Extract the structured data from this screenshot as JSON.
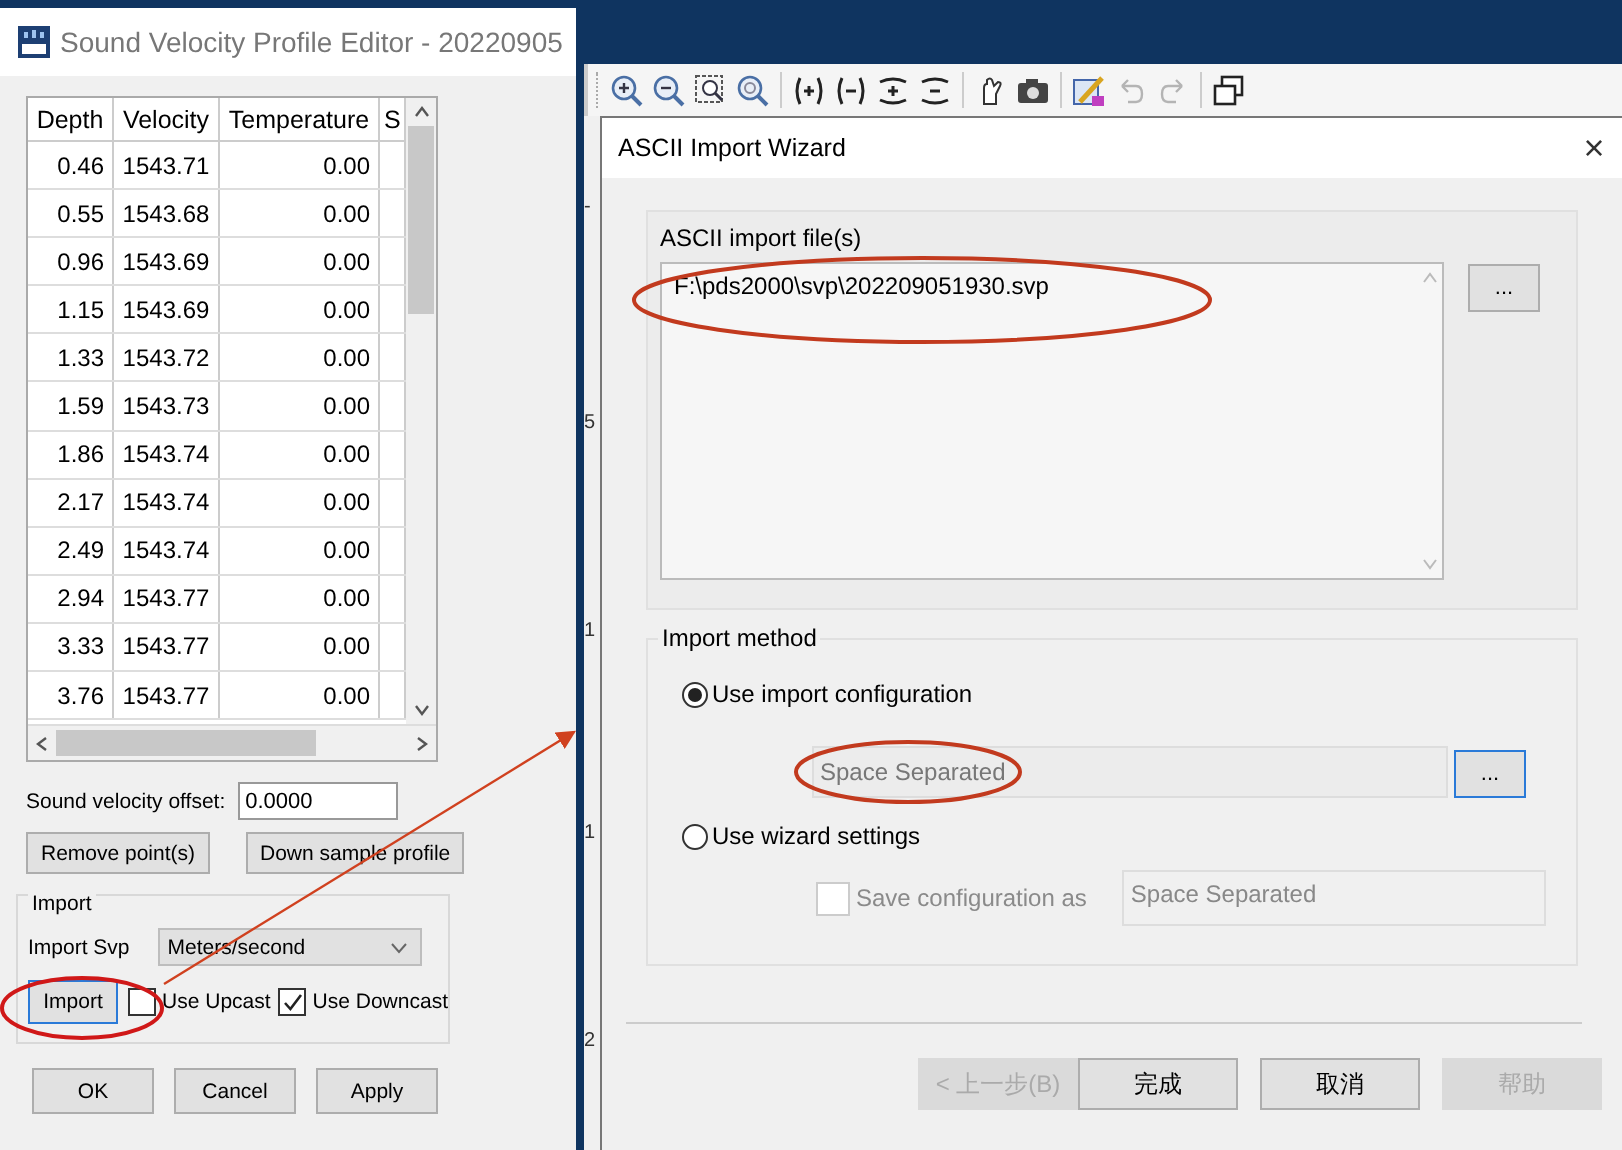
{
  "editor_window": {
    "title": "Sound Velocity Profile Editor - 20220905"
  },
  "table": {
    "columns": [
      "Depth",
      "Velocity",
      "Temperature",
      "S"
    ],
    "rows": [
      [
        "0.46",
        "1543.71",
        "0.00"
      ],
      [
        "0.55",
        "1543.68",
        "0.00"
      ],
      [
        "0.96",
        "1543.69",
        "0.00"
      ],
      [
        "1.15",
        "1543.69",
        "0.00"
      ],
      [
        "1.33",
        "1543.72",
        "0.00"
      ],
      [
        "1.59",
        "1543.73",
        "0.00"
      ],
      [
        "1.86",
        "1543.74",
        "0.00"
      ],
      [
        "2.17",
        "1543.74",
        "0.00"
      ],
      [
        "2.49",
        "1543.74",
        "0.00"
      ],
      [
        "2.94",
        "1543.77",
        "0.00"
      ],
      [
        "3.33",
        "1543.77",
        "0.00"
      ],
      [
        "3.76",
        "1543.77",
        "0.00"
      ]
    ]
  },
  "offset": {
    "label": "Sound velocity offset:",
    "value": "0.0000"
  },
  "edit_buttons": [
    "Remove point(s)",
    "Down sample profile"
  ],
  "import_group": {
    "title": "Import",
    "svp_label": "Import Svp",
    "svp_unit": "Meters/second",
    "import_button": "Import",
    "options": [
      {
        "label": "Use Upcast",
        "checked": false
      },
      {
        "label": "Use Downcast",
        "checked": true
      }
    ]
  },
  "dialog_buttons": [
    "OK",
    "Cancel",
    "Apply"
  ],
  "toolbar": [
    {
      "kind": "zoom-in",
      "disabled": false
    },
    {
      "kind": "zoom-out",
      "disabled": false
    },
    {
      "kind": "zoom-box",
      "disabled": false
    },
    {
      "kind": "zoom-fit",
      "disabled": false
    },
    {
      "kind": "sep"
    },
    {
      "kind": "expand-h",
      "disabled": false
    },
    {
      "kind": "shrink-h",
      "disabled": false
    },
    {
      "kind": "expand-v",
      "disabled": false
    },
    {
      "kind": "shrink-v",
      "disabled": false
    },
    {
      "kind": "sep"
    },
    {
      "kind": "hand",
      "disabled": false
    },
    {
      "kind": "camera",
      "disabled": false
    },
    {
      "kind": "sep"
    },
    {
      "kind": "edit",
      "disabled": false
    },
    {
      "kind": "undo",
      "disabled": true
    },
    {
      "kind": "redo",
      "disabled": true
    },
    {
      "kind": "sep"
    },
    {
      "kind": "windows",
      "disabled": false
    }
  ],
  "axis_labels": [
    "-",
    "5",
    "1",
    "1",
    "2"
  ],
  "wizard": {
    "title": "ASCII Import Wizard",
    "close": "×",
    "file_group": {
      "title": "ASCII import file(s)",
      "files": [
        "F:\\pds2000\\svp\\202209051930.svp"
      ],
      "browse": "..."
    },
    "method_group": {
      "title": "Import method",
      "methods": [
        {
          "label": "Use import configuration",
          "selected": true
        },
        {
          "label": "Use wizard settings",
          "selected": false
        }
      ],
      "config_value": "Space Separated",
      "config_browse": "...",
      "save_config": {
        "label": "Save configuration as",
        "checked": false,
        "disabled": true,
        "value": "Space Separated"
      }
    },
    "buttons": [
      {
        "label": "< 上一步(B)",
        "disabled": true
      },
      {
        "label": "完成",
        "disabled": false
      },
      {
        "label": "取消",
        "disabled": false
      },
      {
        "label": "帮助",
        "disabled": true
      }
    ]
  }
}
